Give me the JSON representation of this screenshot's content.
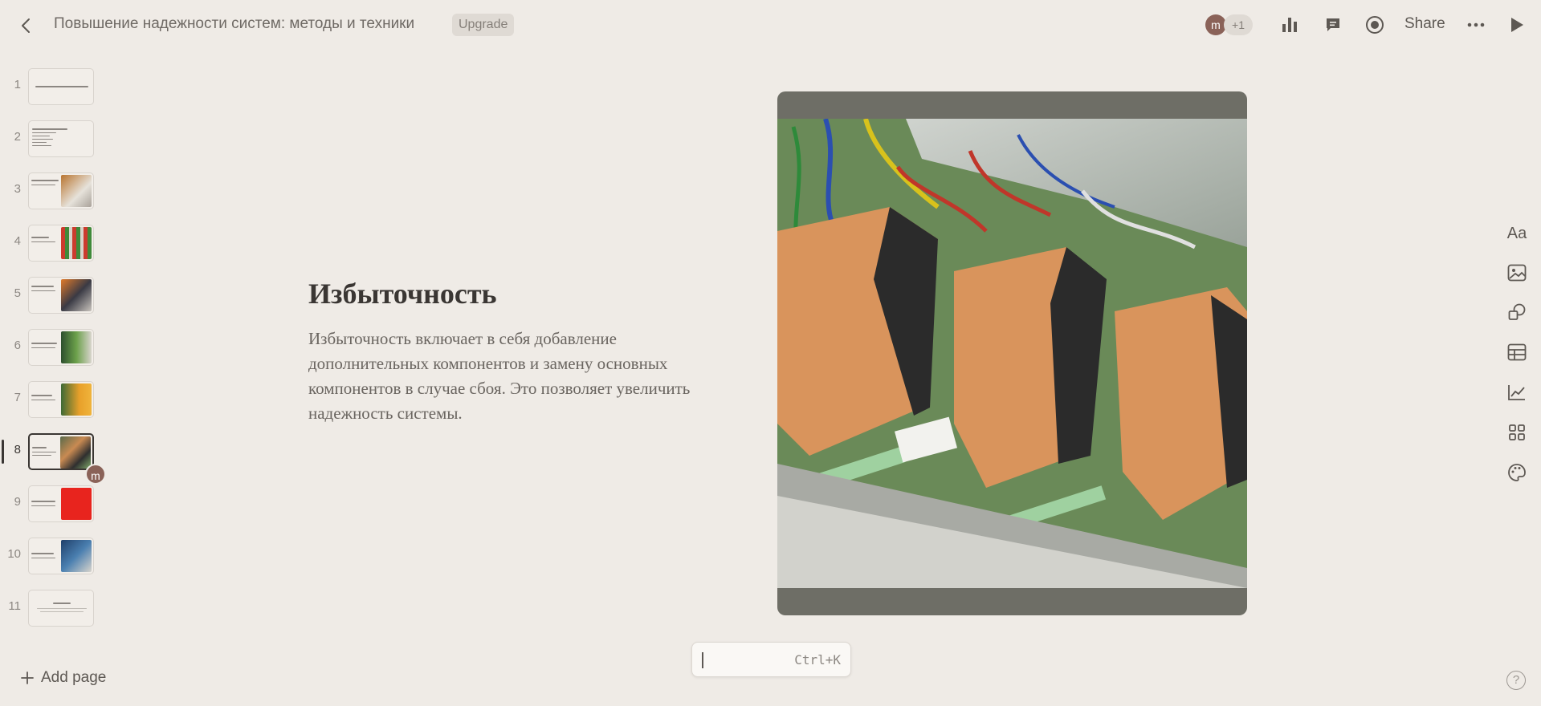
{
  "header": {
    "title": "Повышение надежности систем: методы и техники",
    "upgrade_label": "Upgrade",
    "avatar_initial": "m",
    "collaborators_more": "+1",
    "share_label": "Share",
    "icons": [
      "back-arrow-icon",
      "bar-chart-icon",
      "comment-icon",
      "record-icon",
      "more-icon",
      "play-icon"
    ]
  },
  "thumbnails": [
    {
      "num": "1"
    },
    {
      "num": "2"
    },
    {
      "num": "3"
    },
    {
      "num": "4"
    },
    {
      "num": "5"
    },
    {
      "num": "6"
    },
    {
      "num": "7"
    },
    {
      "num": "8"
    },
    {
      "num": "9"
    },
    {
      "num": "10"
    },
    {
      "num": "11"
    }
  ],
  "active_slide": "8",
  "thumb_avatar": "m",
  "add_page_label": "Add page",
  "slide": {
    "heading": "Избыточность",
    "body": "Избыточность включает в себя добавление дополнительных компонентов и замену основных компонентов в случае сбоя. Это позволяет увеличить надежность системы."
  },
  "right_tools": {
    "text_label": "Aa",
    "icons": [
      "text-icon",
      "image-icon",
      "shapes-icon",
      "table-icon",
      "chart-icon",
      "grid-icon",
      "palette-icon"
    ]
  },
  "command_box": {
    "shortcut": "Ctrl+K"
  },
  "help_label": "?"
}
